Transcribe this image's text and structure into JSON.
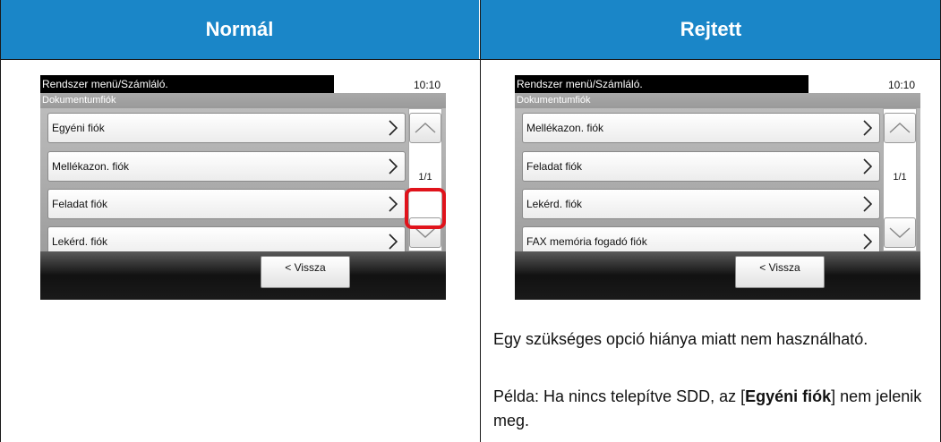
{
  "headers": {
    "left": "Normál",
    "right": "Rejtett"
  },
  "colors": {
    "header_bg": "#1a86c8",
    "highlight": "#e0131b"
  },
  "normal": {
    "title": "Rendszer menü/Számláló.",
    "time": "10:10",
    "subtitle": "Dokumentumfiók",
    "items": [
      {
        "label": "Egyéni fiók"
      },
      {
        "label": "Mellékazon. fiók"
      },
      {
        "label": "Feladat fiók"
      },
      {
        "label": "Lekérd. fiók"
      }
    ],
    "page": "1/1",
    "back": "< Vissza"
  },
  "hidden": {
    "title": "Rendszer menü/Számláló.",
    "time": "10:10",
    "subtitle": "Dokumentumfiók",
    "items": [
      {
        "label": "Mellékazon. fiók"
      },
      {
        "label": "Feladat fiók"
      },
      {
        "label": "Lekérd. fiók"
      },
      {
        "label": "FAX memória fogadó fiók"
      }
    ],
    "page": "1/1",
    "back": "< Vissza"
  },
  "description": {
    "para1": "Egy szükséges opció hiánya miatt nem használható.",
    "para2_pre": "Példa: Ha nincs telepítve SDD, az [",
    "para2_bold": "Egyéni fiók",
    "para2_post": "] nem jelenik meg."
  }
}
